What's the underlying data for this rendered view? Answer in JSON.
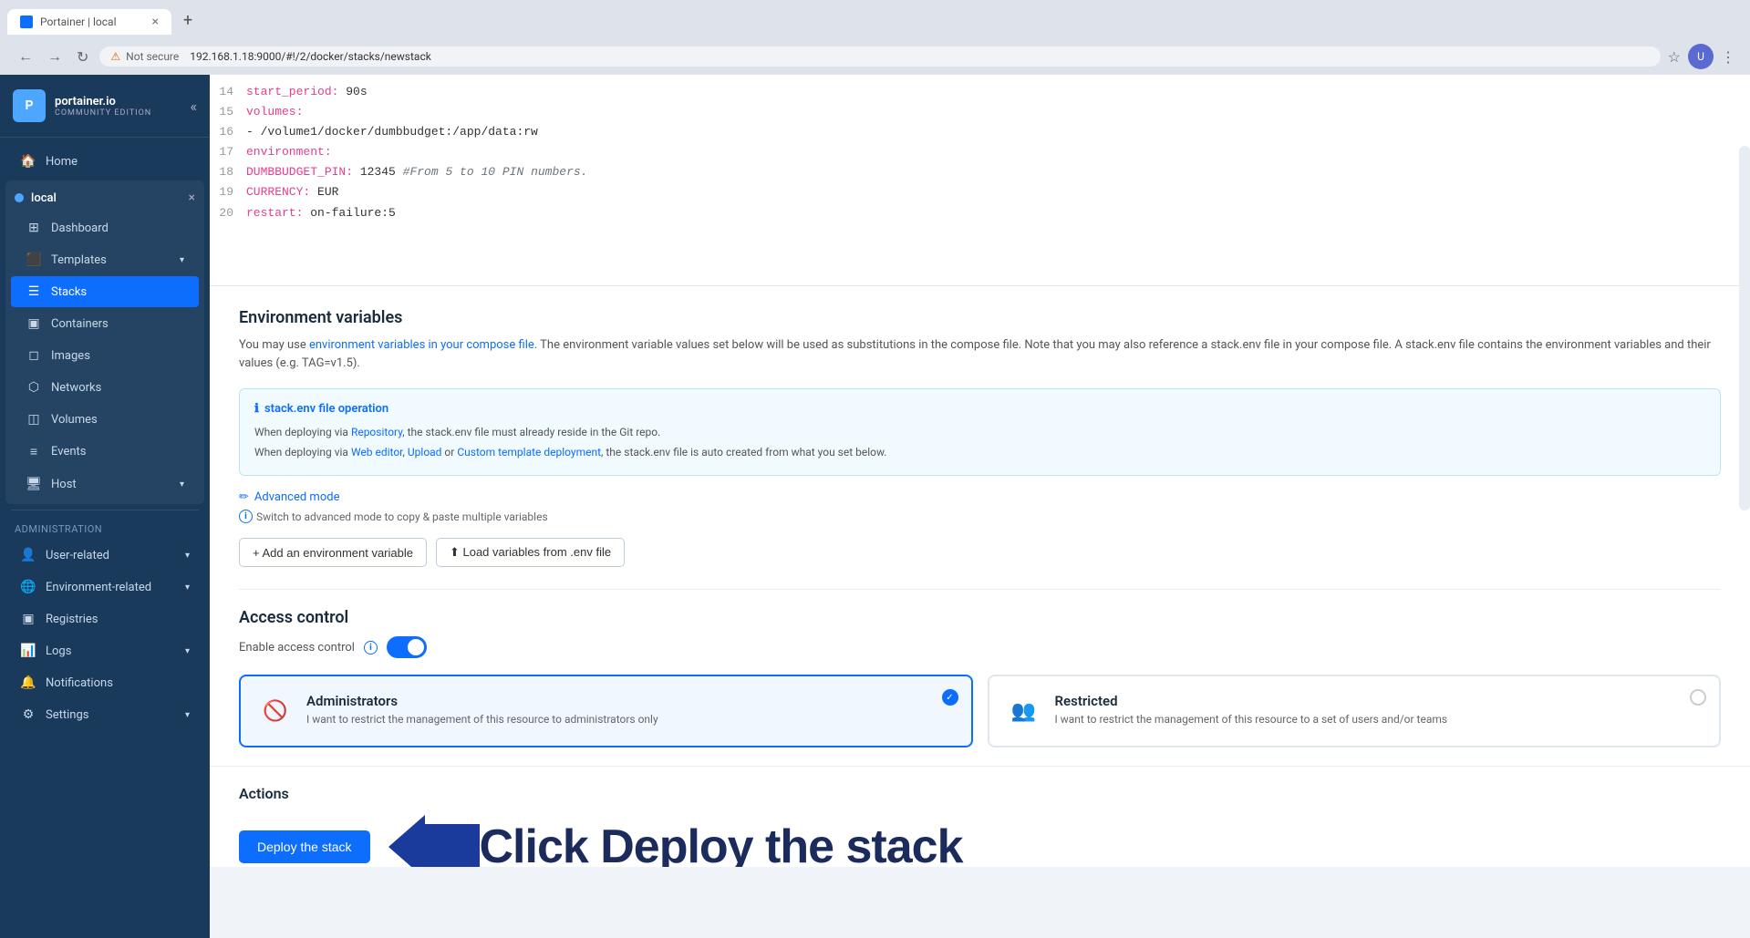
{
  "browser": {
    "tab_label": "Portainer | local",
    "tab_close": "×",
    "url": "192.168.1.18:9000/#!/2/docker/stacks/newstack",
    "security_warning": "Not secure"
  },
  "sidebar": {
    "logo_text": "portainer.io",
    "logo_sub": "COMMUNITY EDITION",
    "collapse_icon": "«",
    "home_label": "Home",
    "environment_name": "local",
    "env_close": "×",
    "items": [
      {
        "label": "Dashboard",
        "icon": "⊞"
      },
      {
        "label": "Templates",
        "icon": "⬛",
        "arrow": "▾"
      },
      {
        "label": "Stacks",
        "icon": "☰",
        "active": true
      },
      {
        "label": "Containers",
        "icon": "▣"
      },
      {
        "label": "Images",
        "icon": "◻"
      },
      {
        "label": "Networks",
        "icon": "⬡"
      },
      {
        "label": "Volumes",
        "icon": "◫"
      },
      {
        "label": "Events",
        "icon": "≡"
      },
      {
        "label": "Host",
        "icon": "⬛",
        "arrow": "▾"
      }
    ],
    "admin_label": "Administration",
    "admin_items": [
      {
        "label": "User-related",
        "icon": "👤",
        "arrow": "▾"
      },
      {
        "label": "Environment-related",
        "icon": "🌐",
        "arrow": "▾"
      },
      {
        "label": "Registries",
        "icon": "▣"
      },
      {
        "label": "Logs",
        "icon": "📊",
        "arrow": "▾"
      },
      {
        "label": "Notifications",
        "icon": "🔔"
      },
      {
        "label": "Settings",
        "icon": "⚙",
        "arrow": "▾"
      }
    ]
  },
  "code": {
    "lines": [
      {
        "num": "14",
        "content": "    start_period: 90s",
        "type": "plain"
      },
      {
        "num": "15",
        "content": "  volumes:",
        "type": "key"
      },
      {
        "num": "16",
        "content": "    - /volume1/docker/dumbbudget:/app/data:rw",
        "type": "plain"
      },
      {
        "num": "17",
        "content": "  environment:",
        "type": "key"
      },
      {
        "num": "18",
        "content": "    DUMBBUDGET_PIN: 12345  #From 5 to 10 PIN numbers.",
        "type": "env"
      },
      {
        "num": "19",
        "content": "    CURRENCY: EUR",
        "type": "plain"
      },
      {
        "num": "20",
        "content": "  restart: on-failure:5",
        "type": "plain"
      }
    ]
  },
  "env_section": {
    "title": "Environment variables",
    "desc_before": "You may use ",
    "desc_link": "environment variables in your compose file",
    "desc_after": ". The environment variable values set below will be used as substitutions in the compose file. Note that you may also reference a stack.env file in your compose file. A stack.env file contains the environment variables and their values (e.g. TAG=v1.5).",
    "info_box": {
      "title": "stack.env file operation",
      "line1_before": "When deploying via ",
      "line1_link": "Repository",
      "line1_after": ", the stack.env file must already reside in the Git repo.",
      "line2_before": "When deploying via ",
      "line2_link1": "Web editor",
      "line2_sep1": ", ",
      "line2_link2": "Upload",
      "line2_sep2": " or ",
      "line2_link3": "Custom template deployment",
      "line2_after": ", the stack.env file is auto created from what you set below."
    },
    "advanced_mode_label": "Advanced mode",
    "advanced_mode_sub": "Switch to advanced mode to copy & paste multiple variables",
    "add_var_btn": "+ Add an environment variable",
    "load_env_btn": "⬆ Load variables from .env file"
  },
  "access_section": {
    "title": "Access control",
    "enable_label": "Enable access control",
    "cards": [
      {
        "title": "Administrators",
        "desc": "I want to restrict the management of this resource to administrators only",
        "selected": true
      },
      {
        "title": "Restricted",
        "desc": "I want to restrict the management of this resource to a set of users and/or teams",
        "selected": false
      }
    ]
  },
  "actions": {
    "title": "Actions",
    "deploy_btn": "Deploy the stack",
    "annotation_text": "Click Deploy the stack"
  }
}
